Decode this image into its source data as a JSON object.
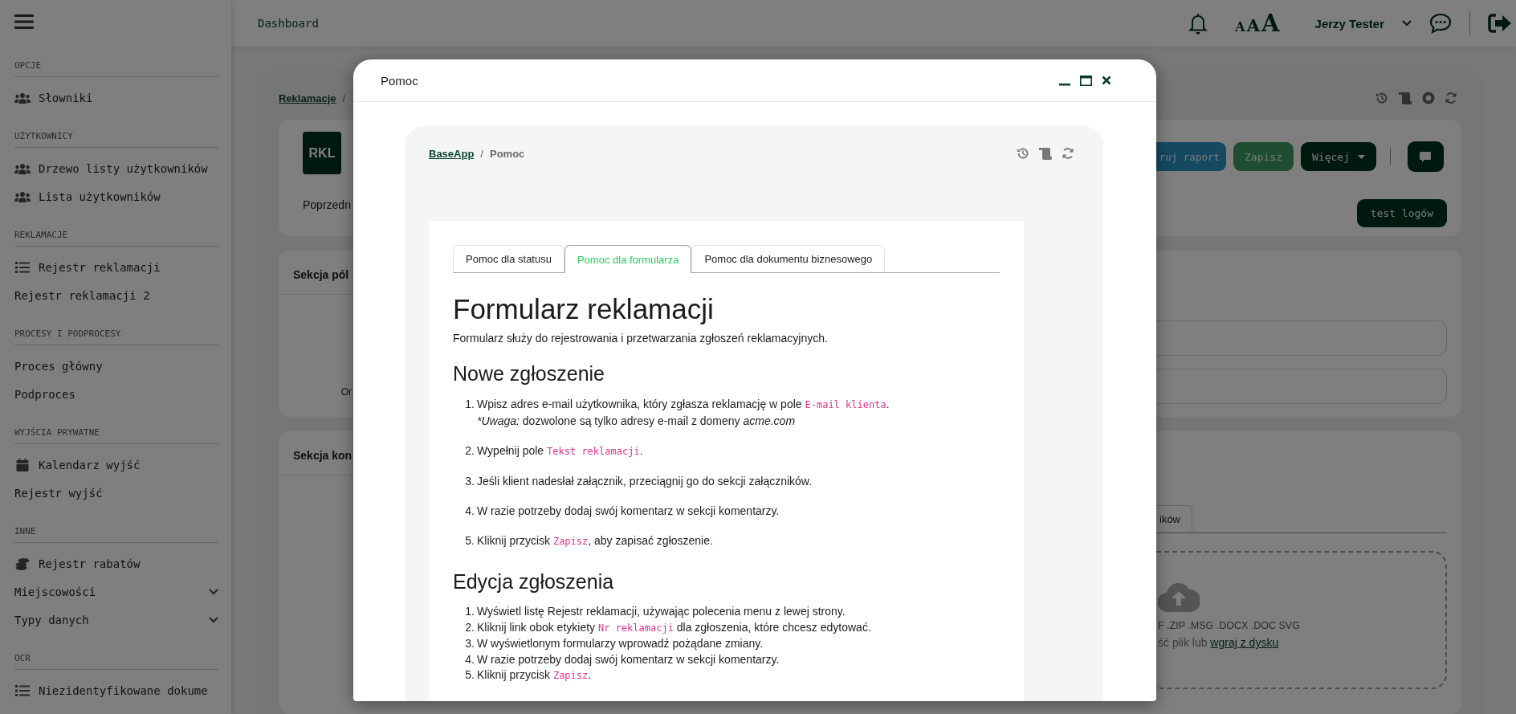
{
  "sidebar": {
    "sections": [
      {
        "title": "OPCJE",
        "items": [
          {
            "label": "Słowniki",
            "kind": "users"
          }
        ]
      },
      {
        "title": "UŻYTKOWNICY",
        "items": [
          {
            "label": "Drzewo listy użytkowników",
            "kind": "users"
          },
          {
            "label": "Lista użytkowników",
            "kind": "users"
          }
        ]
      },
      {
        "title": "REKLAMACJE",
        "items": [
          {
            "label": "Rejestr reklamacji",
            "kind": "list"
          },
          {
            "label": "Rejestr reklamacji 2",
            "kind": "plain"
          }
        ]
      },
      {
        "title": "PROCESY I PODPROCESY",
        "items": [
          {
            "label": "Proces główny",
            "kind": "plain"
          },
          {
            "label": "Podproces",
            "kind": "plain"
          }
        ]
      },
      {
        "title": "WYJŚCIA PRYWATNE",
        "items": [
          {
            "label": "Kalendarz wyjść",
            "kind": "calendar"
          },
          {
            "label": "Rejestr wyjść",
            "kind": "plain"
          }
        ]
      },
      {
        "title": "INNE",
        "items": [
          {
            "label": "Rejestr rabatów",
            "kind": "coins"
          },
          {
            "label": "Miejscowości",
            "kind": "group",
            "expanded": false
          },
          {
            "label": "Typy danych",
            "kind": "group",
            "expanded": false
          }
        ]
      },
      {
        "title": "OCR",
        "items": [
          {
            "label": "Niezidentyfikowane dokume",
            "kind": "list"
          }
        ]
      }
    ]
  },
  "topbar": {
    "title": "Dashboard",
    "text_sizes": [
      "A",
      "A",
      "A"
    ],
    "user": "Jerzy Tester"
  },
  "page": {
    "breadcrumb": {
      "items": [
        "Reklamacje"
      ],
      "separator": "/"
    },
    "header_card": {
      "badge": "RKL",
      "label": "Poprzedn",
      "buttons": [
        {
          "label": "ruj raport",
          "kind": "info"
        },
        {
          "label": "Zapisz",
          "kind": "success"
        },
        {
          "label": "Więcej",
          "kind": "dropdown"
        },
        {
          "kind": "comment"
        }
      ],
      "extra_button": "test logów"
    },
    "fields_section": {
      "title": "Sekcja pól",
      "label": "Or"
    },
    "comments_section": {
      "title": "Sekcja kon",
      "tab": "ików",
      "formats": "F .ZIP .MSG .DOCX .DOC SVG",
      "prompt": "ść plik lub",
      "upload_link": "wgraj z dysku"
    }
  },
  "modal": {
    "title": "Pomoc",
    "breadcrumb": {
      "items": [
        "BaseApp",
        "Pomoc"
      ],
      "separator": "/"
    },
    "tabs": [
      {
        "label": "Pomoc dla statusu",
        "selected": false
      },
      {
        "label": "Pomoc dla formularza",
        "selected": true
      },
      {
        "label": "Pomoc dla dokumentu biznesowego",
        "selected": false
      }
    ],
    "heading": "Formularz reklamacji",
    "intro": "Formularz służy do rejestrowania i przetwarzania zgłoszeń reklamacyjnych.",
    "sections": [
      {
        "heading": "Nowe zgłoszenie",
        "kind": "spaced",
        "steps": [
          {
            "number": "1.",
            "segments": [
              {
                "kind": "text",
                "text": "Wpisz adres e-mail użytkownika, który zgłasza reklamację w pole "
              },
              {
                "kind": "code",
                "text": "E-mail klienta"
              },
              {
                "kind": "text",
                "text": "."
              }
            ],
            "note": [
              {
                "kind": "italic",
                "text": "*Uwaga:"
              },
              {
                "kind": "text",
                "text": " dozwolone są tylko adresy e-mail z domeny "
              },
              {
                "kind": "italic",
                "text": "acme.com"
              }
            ]
          },
          {
            "number": "2.",
            "segments": [
              {
                "kind": "text",
                "text": "Wypełnij pole "
              },
              {
                "kind": "code",
                "text": "Tekst reklamacji"
              },
              {
                "kind": "text",
                "text": "."
              }
            ]
          },
          {
            "number": "3.",
            "segments": [
              {
                "kind": "text",
                "text": "Jeśli klient nadesłał załącznik, przeciągnij go do sekcji załączników."
              }
            ]
          },
          {
            "number": "4.",
            "segments": [
              {
                "kind": "text",
                "text": "W razie potrzeby dodaj swój komentarz w sekcji komentarzy."
              }
            ]
          },
          {
            "number": "5.",
            "segments": [
              {
                "kind": "text",
                "text": "Kliknij przycisk "
              },
              {
                "kind": "code",
                "text": "Zapisz"
              },
              {
                "kind": "text",
                "text": ", aby zapisać zgłoszenie."
              }
            ]
          }
        ]
      },
      {
        "heading": "Edycja zgłoszenia",
        "kind": "compact",
        "steps": [
          {
            "number": "1.",
            "segments": [
              {
                "kind": "text",
                "text": "Wyświetl listę Rejestr reklamacji, używając polecenia menu z lewej strony."
              }
            ]
          },
          {
            "number": "2.",
            "segments": [
              {
                "kind": "text",
                "text": "Kliknij link obok etykiety "
              },
              {
                "kind": "code",
                "text": "Nr reklamacji"
              },
              {
                "kind": "text",
                "text": " dla zgłoszenia, które chcesz edytować."
              }
            ]
          },
          {
            "number": "3.",
            "segments": [
              {
                "kind": "text",
                "text": "W wyświetlonym formularzy wprowadź pożądane zmiany."
              }
            ]
          },
          {
            "number": "4.",
            "segments": [
              {
                "kind": "text",
                "text": "W razie potrzeby dodaj swój komentarz w sekcji komentarzy."
              }
            ]
          },
          {
            "number": "5.",
            "segments": [
              {
                "kind": "text",
                "text": "Kliknij przycisk "
              },
              {
                "kind": "code",
                "text": "Zapisz"
              },
              {
                "kind": "text",
                "text": "."
              }
            ]
          }
        ]
      }
    ]
  }
}
